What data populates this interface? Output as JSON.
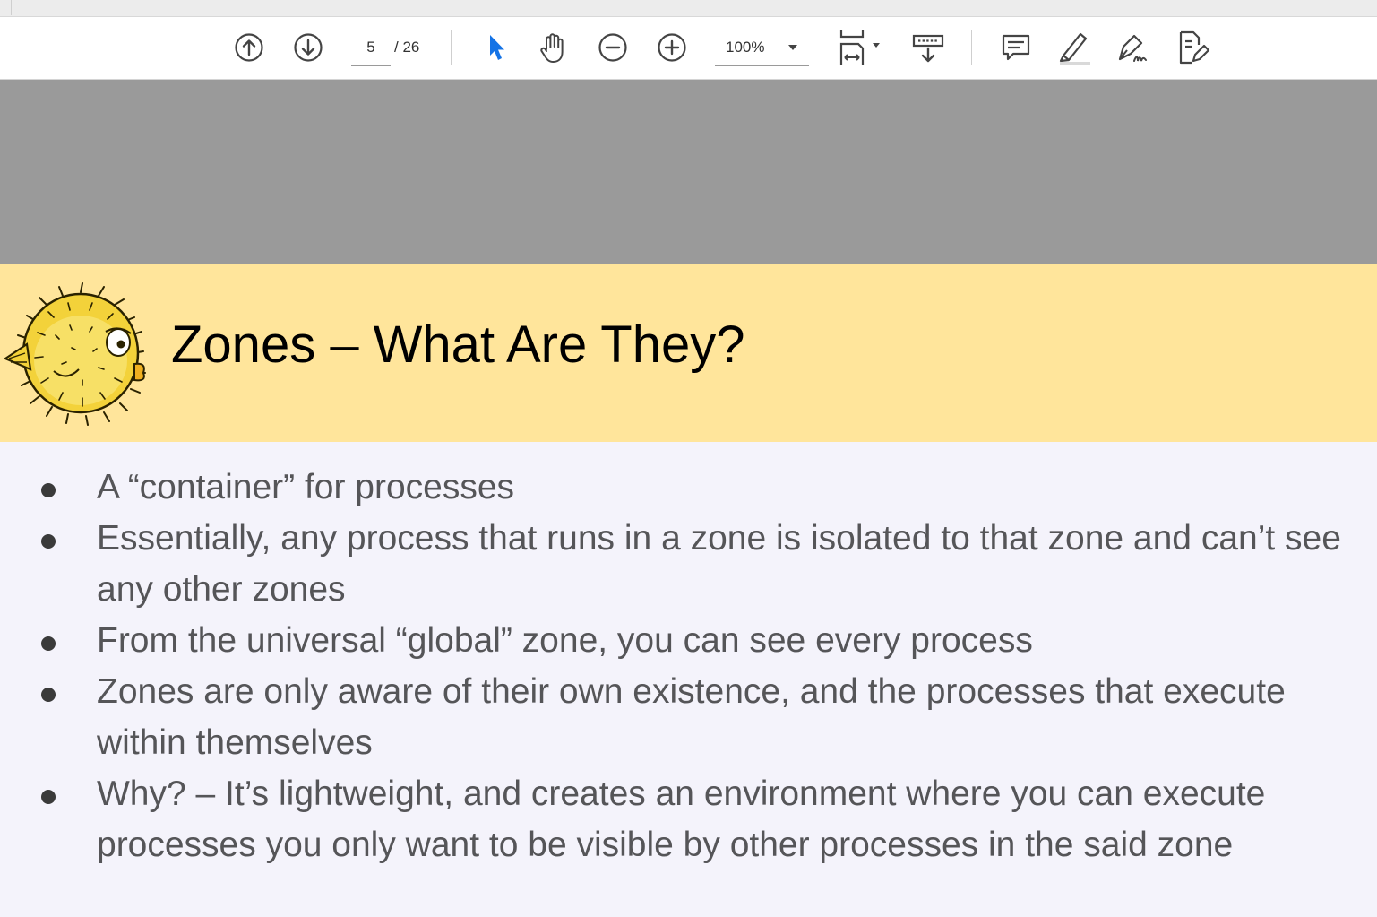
{
  "viewer": {
    "page_current": "5",
    "page_total": "/ 26",
    "zoom": "100%",
    "tools": {
      "prev_page": "arrow-up-circle-icon",
      "next_page": "arrow-down-circle-icon",
      "select": "cursor-arrow-icon",
      "hand": "hand-icon",
      "zoom_out": "minus-circle-icon",
      "zoom_in": "plus-circle-icon",
      "fit": "fit-page-icon",
      "scroll": "scroll-mode-icon",
      "comment": "comment-icon",
      "highlight": "highlighter-icon",
      "sign": "sign-pen-icon",
      "edit": "edit-document-icon"
    },
    "accent_color": "#1473e6"
  },
  "slide": {
    "title": "Zones – What Are They?",
    "header_color": "#ffe59b",
    "bullets": [
      "A “container” for processes",
      "Essentially, any process that runs in a zone is isolated to that zone and can’t see any other zones",
      "From the universal “global” zone, you can see every process",
      "Zones are only aware of their own existence, and the processes that execute within themselves",
      "Why? – It’s lightweight, and creates an environment where you can execute processes you only want to be visible by other processes in the said zone"
    ]
  }
}
